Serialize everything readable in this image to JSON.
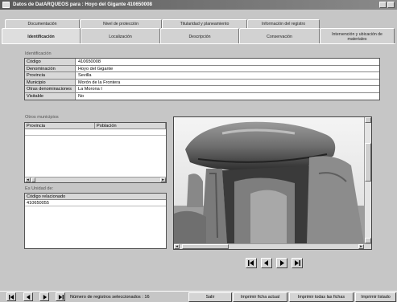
{
  "window": {
    "title": "Datos de DatARQUEOS para : Hoyo del Gigante  410650008"
  },
  "tabs_row1": [
    {
      "label": "Documentación"
    },
    {
      "label": "Nivel de protección"
    },
    {
      "label": "Titularidad y planeamiento"
    },
    {
      "label": "Información del registro"
    }
  ],
  "tabs_row2": [
    {
      "label": "Identificación"
    },
    {
      "label": "Localización"
    },
    {
      "label": "Descripción"
    },
    {
      "label": "Conservación"
    },
    {
      "label": "Intervención y ubicación de materiales"
    }
  ],
  "identificacion": {
    "group_label": "Identificación",
    "rows": [
      {
        "key": "Código",
        "value": "410650008"
      },
      {
        "key": "Denominación",
        "value": "Hoyo del Gigante"
      },
      {
        "key": "Provincia",
        "value": "Sevilla"
      },
      {
        "key": "Municipio",
        "value": "Morón de la Frontera"
      },
      {
        "key": "Otras denominaciones",
        "value": "La Morona I"
      },
      {
        "key": "Visitable",
        "value": "No"
      }
    ]
  },
  "otros_municipios": {
    "group_label": "Otros municipios",
    "columns": [
      "Provincia",
      "Población"
    ]
  },
  "unidad": {
    "group_label": "Es Unidad de:",
    "column": "Código relacionado",
    "rows": [
      "410650055"
    ]
  },
  "photo": {
    "alt": "Dolmen"
  },
  "status": {
    "text": "Número de registros seleccionados : 16"
  },
  "buttons": {
    "salir": "Salir",
    "imprimir_actual": "Imprimir ficha actual",
    "imprimir_todas": "Imprimir todas las fichas",
    "imprimir_listado": "Imprimir listado"
  }
}
